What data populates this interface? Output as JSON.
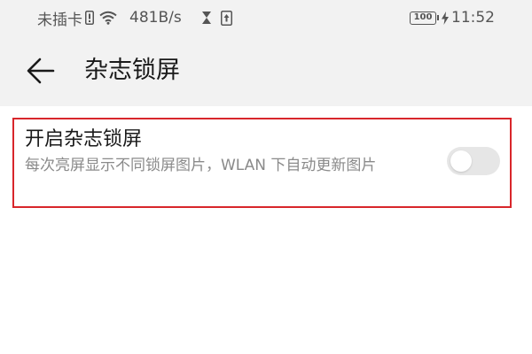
{
  "status_bar": {
    "carrier": "未插卡",
    "speed": "481B/s",
    "battery": "100",
    "time": "11:52",
    "icons": [
      "sim-status-icon",
      "wifi-icon",
      "hourglass-icon",
      "upload-icon",
      "battery-icon",
      "charging-bolt-icon"
    ]
  },
  "app_bar": {
    "title": "杂志锁屏",
    "back_icon": "back-arrow-icon"
  },
  "setting": {
    "title": "开启杂志锁屏",
    "description": "每次亮屏显示不同锁屏图片，WLAN 下自动更新图片",
    "toggle_on": false
  },
  "colors": {
    "header_bg": "#f2f2f2",
    "highlight_border": "#d8262b",
    "toggle_off": "#e6e6e6",
    "secondary_text": "#8a8a8a"
  }
}
